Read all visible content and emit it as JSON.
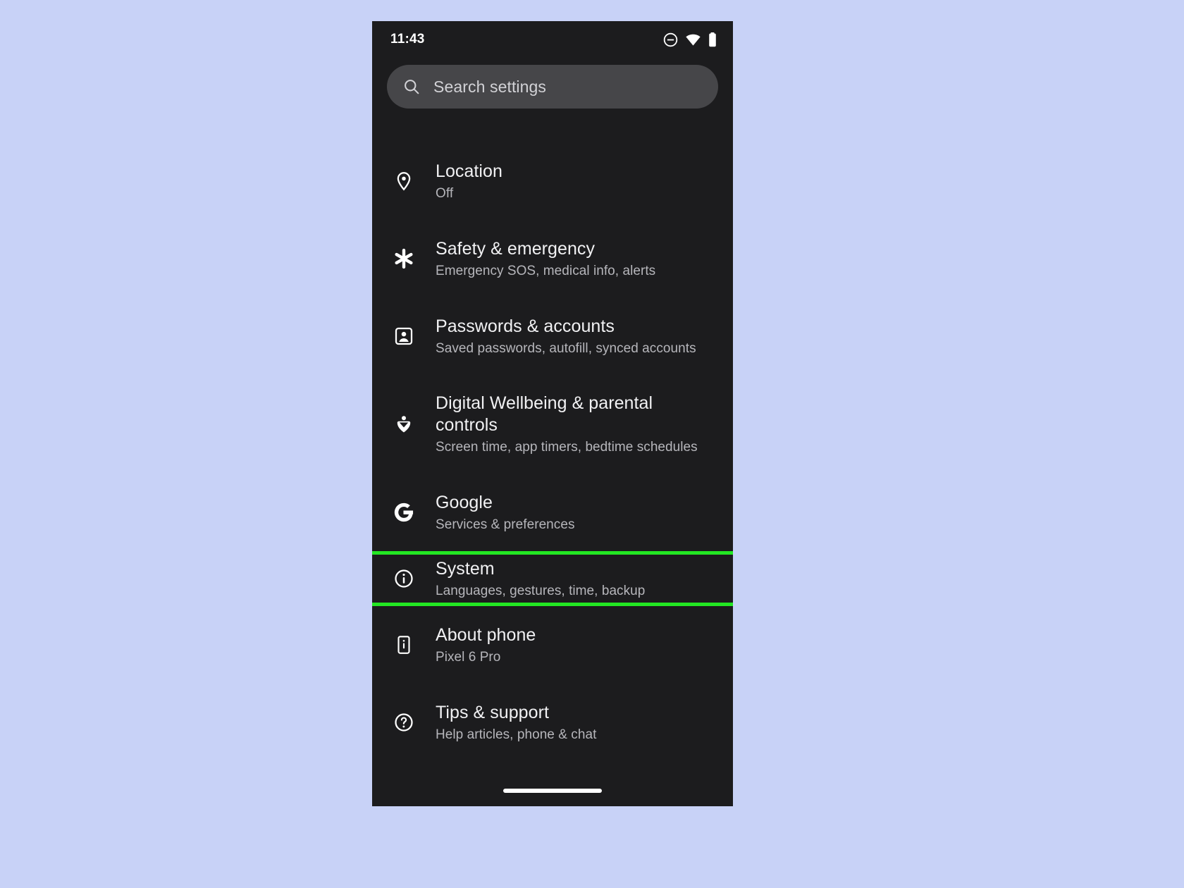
{
  "page": {
    "background_color": "#c8d2f7",
    "screen_background": "#1c1c1e",
    "highlight_color": "#23e723"
  },
  "status_bar": {
    "clock": "11:43",
    "icons": [
      {
        "name": "do-not-disturb-icon",
        "label": "Do not disturb"
      },
      {
        "name": "wifi-icon",
        "label": "Wi-Fi connected"
      },
      {
        "name": "battery-icon",
        "label": "Battery full"
      }
    ]
  },
  "search": {
    "placeholder": "Search settings",
    "value": "",
    "icon": "search-icon"
  },
  "settings_list": {
    "cut_off_row_hint": "",
    "items": [
      {
        "id": "location",
        "icon": "location-pin-icon",
        "title": "Location",
        "subtitle": "Off",
        "highlighted": false
      },
      {
        "id": "safety-emergency",
        "icon": "asterisk-emergency-icon",
        "title": "Safety & emergency",
        "subtitle": "Emergency SOS, medical info, alerts",
        "highlighted": false
      },
      {
        "id": "passwords-accounts",
        "icon": "account-box-icon",
        "title": "Passwords & accounts",
        "subtitle": "Saved passwords, autofill, synced accounts",
        "highlighted": false
      },
      {
        "id": "digital-wellbeing",
        "icon": "digital-wellbeing-icon",
        "title": "Digital Wellbeing & parental controls",
        "subtitle": "Screen time, app timers, bedtime schedules",
        "highlighted": false
      },
      {
        "id": "google",
        "icon": "google-g-icon",
        "title": "Google",
        "subtitle": "Services & preferences",
        "highlighted": false
      },
      {
        "id": "system",
        "icon": "info-circle-icon",
        "title": "System",
        "subtitle": "Languages, gestures, time, backup",
        "highlighted": true
      },
      {
        "id": "about-phone",
        "icon": "phone-info-icon",
        "title": "About phone",
        "subtitle": "Pixel 6 Pro",
        "highlighted": false
      },
      {
        "id": "tips-support",
        "icon": "help-circle-icon",
        "title": "Tips & support",
        "subtitle": "Help articles, phone & chat",
        "highlighted": false
      }
    ]
  },
  "nav_bar": {
    "gesture_pill": "home-gesture-pill"
  }
}
